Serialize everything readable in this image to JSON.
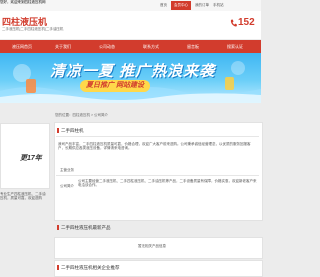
{
  "topbar": {
    "welcome": "您好，欢迎来到四柱液压机网",
    "links": [
      "首页",
      "会员中心",
      "我的订单",
      "手机站"
    ]
  },
  "header": {
    "brand": "四柱液压机",
    "subtitle": "二手液压机|二手四柱液压机|二手油压机",
    "phone": "152"
  },
  "nav": {
    "items": [
      "液压网首页",
      "关于我们",
      "公司动态",
      "联系方式",
      "留言板",
      "搜索认证"
    ]
  },
  "banner": {
    "headline": "清凉一夏 推广热浪来袭",
    "pill": "夏日推广 网站建设"
  },
  "breadcrumb": "您的位置：四柱液压机 > 公司简介",
  "sidebar": {
    "lang": "更17年",
    "desc": "专业生产四柱液压机、二手油压机，质量可靠，欢迎选购"
  },
  "main": {
    "section1_title": "二手四柱机",
    "intro": "我司产品丰富，二手四柱液压机质量可靠，价格合理，欢迎广大客户前来选购。公司秉承诚信经营理念，以优质的服务回报客户，长期供应各类液压设备，详情请来电咨询。",
    "rows": [
      {
        "label": "主营业务",
        "value": ""
      },
      {
        "label": "公司简介",
        "value": "公司主要经营二手液压机、二手四柱液压机、二手油压机等产品，二手设备质量有保障，价格实惠，欢迎新老客户来电洽谈合作。"
      }
    ],
    "section2_title": "二手四柱液压机最新产品",
    "empty_note": "暂无相关产品信息",
    "section3_title": "二手四柱液压机相关企业推荐"
  }
}
